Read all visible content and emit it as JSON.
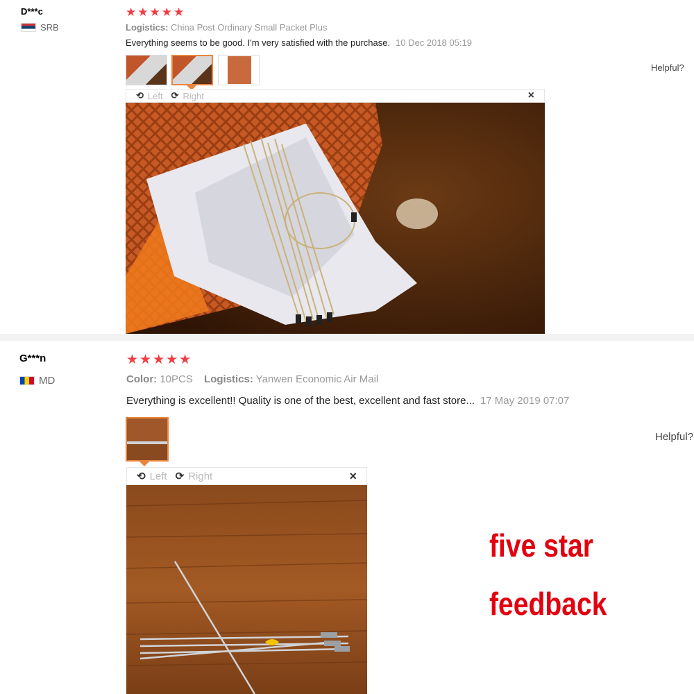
{
  "reviews": [
    {
      "user": "D***c",
      "country_code": "SRB",
      "stars": "★★★★★",
      "logistics_label": "Logistics:",
      "logistics_value": "China Post Ordinary Small Packet Plus",
      "feedback": "Everything seems to be good. I'm very satisfied with the purchase.",
      "date": "10 Dec 2018 05:19",
      "helpful": "Helpful?",
      "viewer": {
        "left": "Left",
        "right": "Right",
        "close": "×"
      }
    },
    {
      "user": "G***n",
      "country_code": "MD",
      "stars": "★★★★★",
      "color_label": "Color:",
      "color_value": "10PCS",
      "logistics_label": "Logistics:",
      "logistics_value": "Yanwen Economic Air Mail",
      "feedback": "Everything is excellent!! Quality is one of the best, excellent and fast store...",
      "date": "17 May 2019 07:07",
      "helpful": "Helpful?",
      "viewer": {
        "left": "Left",
        "right": "Right",
        "close": "×"
      }
    }
  ],
  "promo": {
    "line1": "five star",
    "line2": "feedback"
  },
  "colors": {
    "stars": "#ef3e42",
    "accent": "#e8863c",
    "promo": "#e3000f"
  }
}
